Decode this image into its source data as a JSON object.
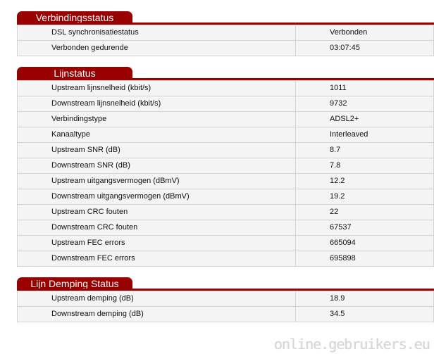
{
  "sections": [
    {
      "title": "Verbindingsstatus",
      "rows": [
        {
          "label": "DSL synchronisatiestatus",
          "value": "Verbonden"
        },
        {
          "label": "Verbonden gedurende",
          "value": "03:07:45"
        }
      ]
    },
    {
      "title": "Lijnstatus",
      "rows": [
        {
          "label": "Upstream lijnsnelheid (kbit/s)",
          "value": "1011"
        },
        {
          "label": "Downstream lijnsnelheid (kbit/s)",
          "value": "9732"
        },
        {
          "label": "Verbindingstype",
          "value": "ADSL2+"
        },
        {
          "label": "Kanaaltype",
          "value": "Interleaved"
        },
        {
          "label": "Upstream SNR (dB)",
          "value": "8.7"
        },
        {
          "label": "Downstream SNR (dB)",
          "value": "7.8"
        },
        {
          "label": "Upstream uitgangsvermogen (dBmV)",
          "value": "12.2"
        },
        {
          "label": "Downstream uitgangsvermogen (dBmV)",
          "value": "19.2"
        },
        {
          "label": "Upstream CRC fouten",
          "value": "22"
        },
        {
          "label": "Downstream CRC fouten",
          "value": "67537"
        },
        {
          "label": "Upstream FEC errors",
          "value": "665094"
        },
        {
          "label": "Downstream FEC errors",
          "value": "695898"
        }
      ]
    },
    {
      "title": "Lijn Demping Status",
      "rows": [
        {
          "label": "Upstream demping (dB)",
          "value": "18.9"
        },
        {
          "label": "Downstream demping (dB)",
          "value": "34.5"
        }
      ]
    }
  ],
  "watermark": "online.gebruikers.eu",
  "colors": {
    "accent": "#990000",
    "row_background": "#f4f4f4",
    "row_border": "#d4d4d4"
  }
}
